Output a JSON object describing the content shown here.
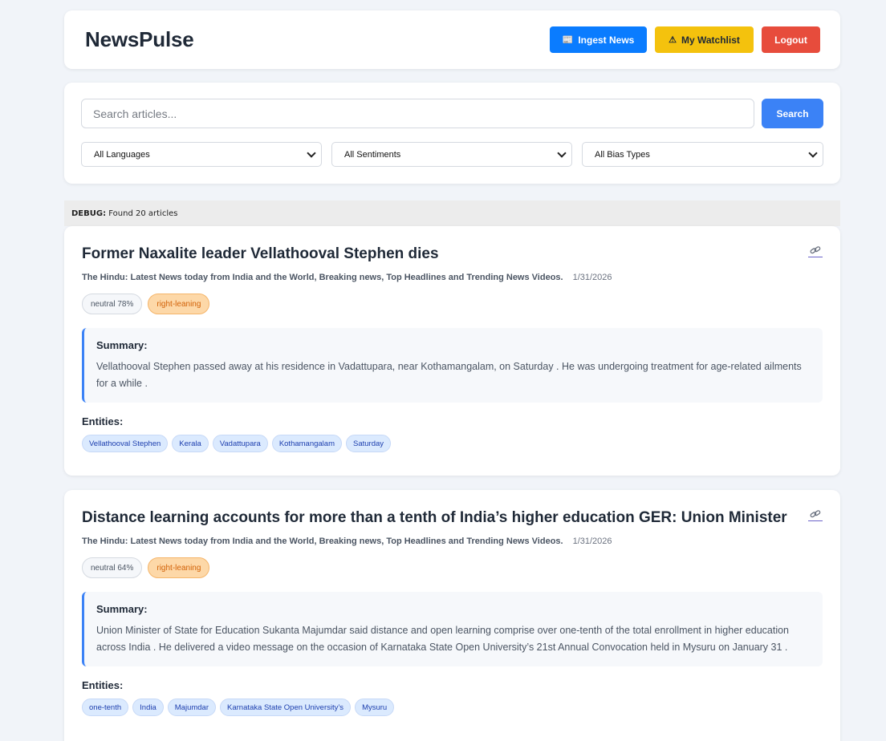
{
  "app": {
    "title": "NewsPulse"
  },
  "header": {
    "ingest_label": "Ingest News",
    "watchlist_label": "My Watchlist",
    "logout_label": "Logout"
  },
  "search": {
    "placeholder": "Search articles...",
    "button_label": "Search",
    "filters": {
      "language": "All Languages",
      "sentiment": "All Sentiments",
      "bias": "All Bias Types"
    }
  },
  "debug": {
    "label": "DEBUG:",
    "text": "Found 20 articles"
  },
  "articles": [
    {
      "title": "Former Naxalite leader Vellathooval Stephen dies",
      "source": "The Hindu: Latest News today from India and the World, Breaking news, Top Headlines and Trending News Videos.",
      "date": "1/31/2026",
      "sentiment": "neutral 78%",
      "bias": "right-leaning",
      "summary_label": "Summary:",
      "summary": "Vellathooval Stephen passed away at his residence in Vadattupara, near Kothamangalam, on Saturday . He was undergoing treatment for age-related ailments for a while .",
      "entities_label": "Entities:",
      "entities": [
        "Vellathooval Stephen",
        "Kerala",
        "Vadattupara",
        "Kothamangalam",
        "Saturday"
      ]
    },
    {
      "title": "Distance learning accounts for more than a tenth of India’s higher education GER: Union Minister",
      "source": "The Hindu: Latest News today from India and the World, Breaking news, Top Headlines and Trending News Videos.",
      "date": "1/31/2026",
      "sentiment": "neutral 64%",
      "bias": "right-leaning",
      "summary_label": "Summary:",
      "summary": "Union Minister of State for Education Sukanta Majumdar said distance and open learning comprise over one-tenth of the total enrollment in higher education across India . He delivered a video message on the occasion of Karnataka State Open University’s 21st Annual Convocation held in Mysuru on January 31 .",
      "entities_label": "Entities:",
      "entities": [
        "one-tenth",
        "India",
        "Majumdar",
        "Karnataka State Open University’s",
        "Mysuru"
      ]
    }
  ],
  "colors": {
    "ingest": "#0a7cff",
    "watchlist": "#f4c20d",
    "logout": "#e74c3c",
    "search": "#3b82f6",
    "bias_tag": "#fdd8a8",
    "entity_tag": "#dbeafe"
  },
  "icons": {
    "ingest": "newspaper-icon",
    "watchlist": "warning-icon",
    "article_link": "link-icon"
  }
}
